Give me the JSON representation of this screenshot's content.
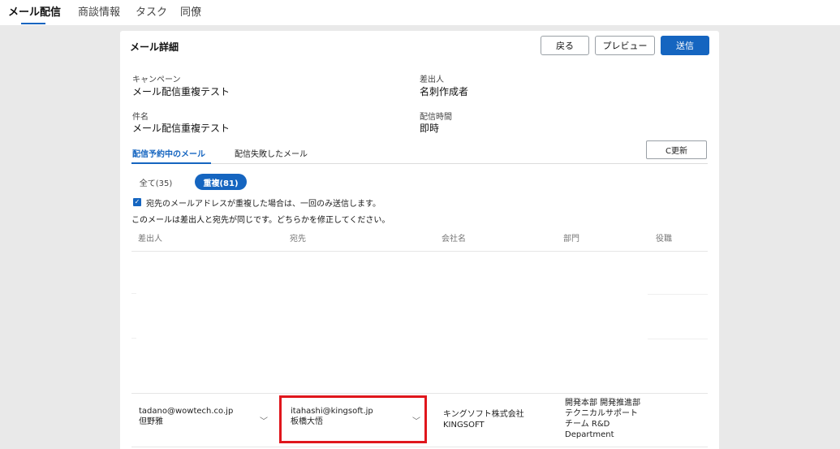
{
  "nav": {
    "tabs": [
      "メール配信",
      "商談情報",
      "タスク",
      "同僚"
    ],
    "active": 0
  },
  "card": {
    "title": "メール詳細",
    "buttons": {
      "back": "戻る",
      "preview": "プレビュー",
      "send": "送信"
    }
  },
  "fields": {
    "campaign_label": "キャンペーン",
    "campaign_value": "メール配信重複テスト",
    "sender_label": "差出人",
    "sender_value": "名刺作成者",
    "subject_label": "件名",
    "subject_value": "メール配信重複テスト",
    "time_label": "配信時間",
    "time_value": "即時"
  },
  "subtabs": {
    "scheduled": "配信予約中のメール",
    "failed": "配信失敗したメール",
    "refresh": "C更新"
  },
  "filters": {
    "all": "全て(35)",
    "duplicate": "重複(81)"
  },
  "option": {
    "dedupe_label": "宛先のメールアドレスが重複した場合は、一回のみ送信します。",
    "notice": "このメールは差出人と宛先が同じです。どちらかを修正してください。"
  },
  "table": {
    "headers": [
      "差出人",
      "宛先",
      "会社名",
      "部門",
      "役職"
    ],
    "row": {
      "sender_email": "tadano@wowtech.co.jp",
      "sender_name": "但野雅",
      "recipient_email": "itahashi@kingsoft.jp",
      "recipient_name": "板橋大悟",
      "company": "キングソフト株式会社 KINGSOFT",
      "department": "開発本部 開発推進部 テクニカルサポートチーム R&D Department",
      "title": ""
    }
  },
  "colors": {
    "accent": "#1565c0",
    "highlight": "#e0161c"
  }
}
